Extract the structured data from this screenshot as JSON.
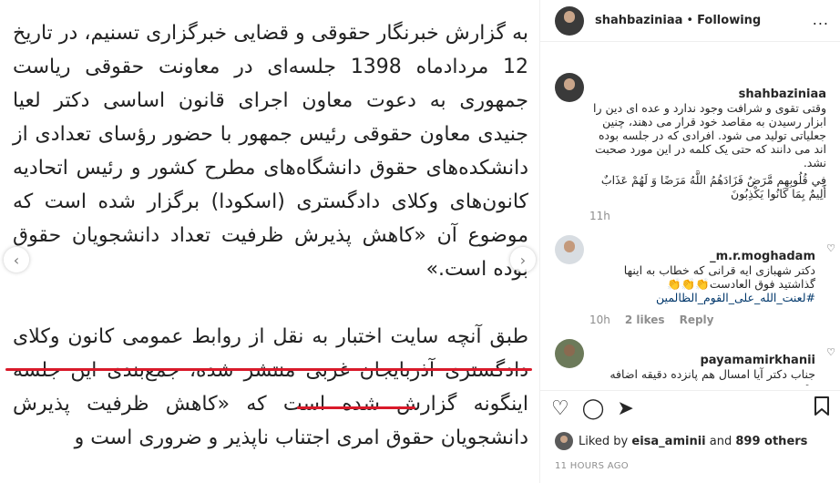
{
  "post": {
    "paragraph1": "به گزارش خبرنگار حقوقی و قضایی خبرگزاری تسنیم، در تاریخ 12 مردادماه 1398 جلسه‌ای در معاونت حقوقی ریاست جمهوری به دعوت معاون اجرای قانون اساسی دکتر لعیا جنیدی معاون حقوقی رئیس جمهور با حضور رؤسای تعدادی از دانشکده‌های حقوق دانشگاه‌های مطرح کشور و رئیس اتحادیه کانون‌های وکلای دادگستری (اسکودا) برگزار شده است که موضوع آن «کاهش پذیرش ظرفیت تعداد دانشجویان حقوق بوده است.»",
    "paragraph2": "طبق آنچه سایت اختبار به نقل از روابط عمومی کانون وکلای دادگستری آذربایجان غربی منتشر شده، جمع‌بندی این جلسه اینگونه گزارش شده است که «کاهش ظرفیت پذیرش دانشجویان حقوق امری اجتناب ناپذیر و ضروری است و",
    "prev_arrow": "‹",
    "next_arrow": "›"
  },
  "header": {
    "username": "shahbaziniaa",
    "separator": "•",
    "follow_status": "Following",
    "more": "..."
  },
  "comments": [
    {
      "username": "shahbaziniaa",
      "text": "وقتی تقوی و شرافت وجود ندارد و عده ای دین را ابزار رسیدن به مقاصد خود قرار می دهند، چنین جعلیاتی تولید می شود. افرادی که در جلسه بوده اند می دانند که حتی یک کلمه در این مورد صحبت نشد.",
      "quran": "فِي قُلُوبِهِم مَّرَضٌ فَزَادَهُمُ اللَّهُ مَرَضًا وَ لَهُمْ عَذَابٌ أَلِيمٌ بِمَا كَانُوا يَكْذِبُونَ",
      "time": "11h"
    },
    {
      "username": "m.r.moghadam_",
      "text": "دکتر شهبازی ایه قرانی که خطاب به اینها گذاشتید فوق العادست👏👏👏",
      "hashtag": "#لعنت_الله_علی_القوم_الظالمین",
      "time": "10h",
      "likes": "2 likes",
      "reply": "Reply"
    },
    {
      "username": "payamamirkhanii",
      "text": "جناب دکتر آیا امسال هم پانزده دقیقه اضافه وقت"
    }
  ],
  "actions": {
    "like_icon": "heart-icon",
    "comment_icon": "comment-icon",
    "share_icon": "share-icon",
    "save_icon": "bookmark-icon"
  },
  "likes": {
    "prefix": "Liked by",
    "user": "eisa_aminii",
    "middle": "and",
    "others": "899 others"
  },
  "time_ago": "11 HOURS AGO",
  "colors": {
    "underline": "#d91a2a",
    "text": "#262626",
    "muted": "#8e8e8e",
    "hashtag": "#00376b"
  }
}
